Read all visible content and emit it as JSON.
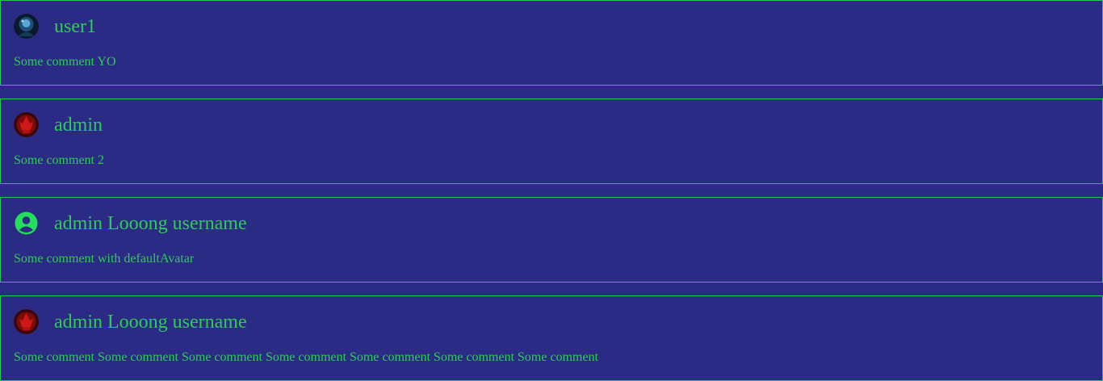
{
  "colors": {
    "background": "#2b2a85",
    "accent": "#2ecc55",
    "border": "#22c55e"
  },
  "comments": [
    {
      "username": "user1",
      "text": "Some comment YO",
      "avatar": "user1-avatar-image"
    },
    {
      "username": "admin",
      "text": "Some comment 2",
      "avatar": "admin-avatar-image"
    },
    {
      "username": "admin Looong username",
      "text": "Some comment with defaultAvatar",
      "avatar": "default-avatar-icon"
    },
    {
      "username": "admin Looong username",
      "text": "Some comment Some comment Some comment Some comment Some comment Some comment Some comment",
      "avatar": "admin-avatar-image"
    }
  ]
}
